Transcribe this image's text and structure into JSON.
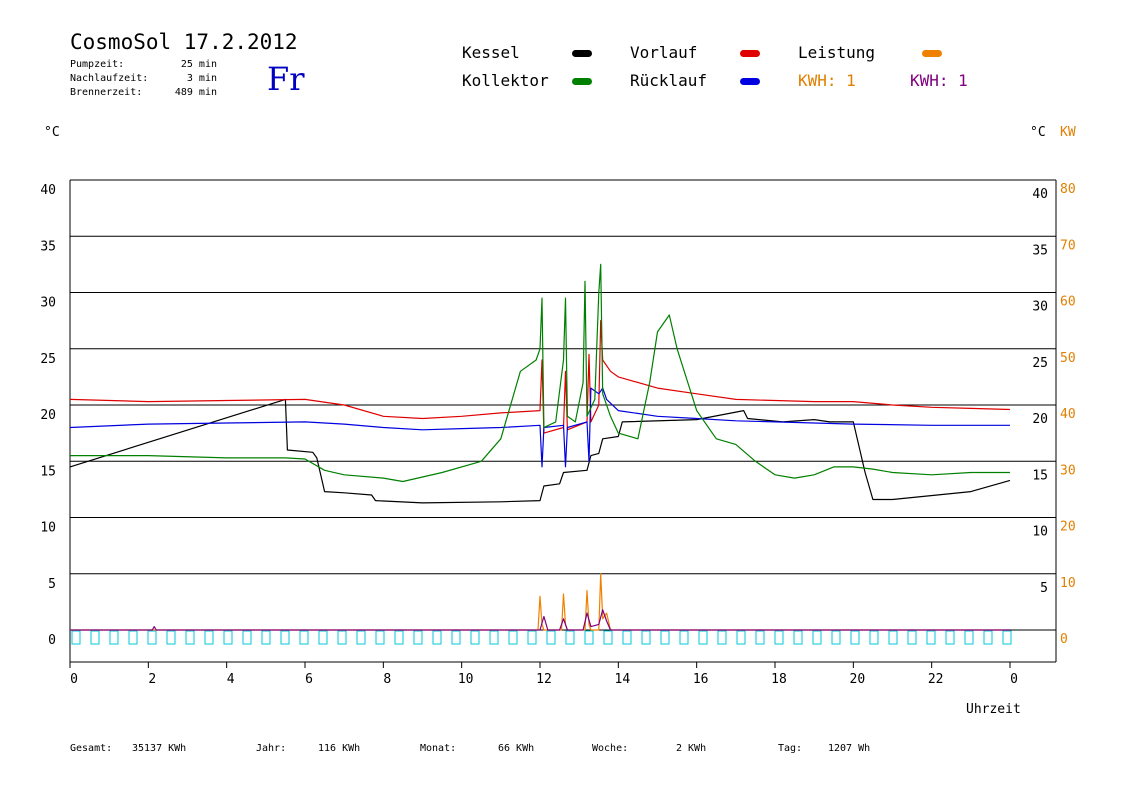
{
  "header": {
    "title": "CosmoSol 17.2.2012",
    "weekday": "Fr",
    "stats": [
      {
        "label": "Pumpzeit:",
        "value": "25 min"
      },
      {
        "label": "Nachlaufzeit:",
        "value": "3 min"
      },
      {
        "label": "Brennerzeit:",
        "value": "489 min"
      }
    ]
  },
  "legend": {
    "items": [
      {
        "label": "Kessel",
        "color": "#000000"
      },
      {
        "label": "Vorlauf",
        "color": "#e00000"
      },
      {
        "label": "Leistung",
        "color": "#f08000"
      },
      {
        "label": "Kollektor",
        "color": "#008000"
      },
      {
        "label": "Rücklauf",
        "color": "#0000e0"
      }
    ],
    "kwh": [
      {
        "label": "KWH: 1",
        "color": "#e08000"
      },
      {
        "label": "KWH: 1",
        "color": "#800080"
      }
    ]
  },
  "axes": {
    "left_unit": "°C",
    "right_unit_c": "°C",
    "right_unit_kw": "KW",
    "xlabel": "Uhrzeit"
  },
  "footer": [
    {
      "label": "Gesamt:",
      "value": "35137 KWh"
    },
    {
      "label": "Jahr:",
      "value": "116 KWh"
    },
    {
      "label": "Monat:",
      "value": "66 KWh"
    },
    {
      "label": "Woche:",
      "value": "2 KWh"
    },
    {
      "label": "Tag:",
      "value": "1207 Wh"
    }
  ],
  "chart_data": {
    "type": "line",
    "xlabel": "Uhrzeit",
    "ylabel": "°C",
    "ylabel_right": "KW",
    "xlim": [
      0,
      24
    ],
    "ylim": [
      -2,
      42
    ],
    "grid": true,
    "x_ticks": [
      "0",
      "2",
      "4",
      "6",
      "8",
      "10",
      "12",
      "14",
      "16",
      "18",
      "20",
      "22",
      "0"
    ],
    "y_ticks_left": [
      "0",
      "5",
      "10",
      "15",
      "20",
      "25",
      "30",
      "35",
      "40"
    ],
    "y_ticks_right_c": [
      "5",
      "10",
      "15",
      "20",
      "25",
      "30",
      "35",
      "40"
    ],
    "y_ticks_right_kw": [
      "0",
      "10",
      "20",
      "30",
      "40",
      "50",
      "60",
      "70",
      "80"
    ],
    "series": [
      {
        "name": "Kessel",
        "color": "#000000",
        "x": [
          0,
          5.5,
          5.55,
          6.2,
          6.3,
          6.5,
          7.0,
          7.7,
          7.8,
          9.0,
          11.0,
          12.0,
          12.1,
          12.5,
          12.6,
          13.2,
          13.3,
          13.5,
          13.6,
          14.0,
          14.1,
          16.0,
          17.2,
          17.3,
          18.2,
          19.0,
          19.4,
          20.0,
          20.3,
          20.5,
          21.0,
          23.0,
          24.0
        ],
        "y": [
          14.5,
          20.5,
          16.0,
          15.8,
          15.3,
          12.3,
          12.2,
          12.0,
          11.5,
          11.3,
          11.4,
          11.5,
          12.8,
          13.0,
          14.0,
          14.2,
          15.5,
          15.7,
          17.0,
          17.2,
          18.5,
          18.7,
          19.5,
          18.8,
          18.5,
          18.7,
          18.5,
          18.5,
          14.0,
          11.6,
          11.6,
          12.3,
          13.3
        ]
      },
      {
        "name": "Vorlauf",
        "color": "#e00000",
        "x": [
          0,
          2,
          4,
          6,
          7,
          8,
          9,
          10,
          11,
          12,
          12.05,
          12.1,
          12.6,
          12.65,
          12.7,
          13.2,
          13.25,
          13.3,
          13.5,
          13.55,
          13.6,
          13.8,
          14.0,
          15.0,
          16.0,
          17.0,
          19.0,
          20.0,
          21.0,
          22.0,
          23.0,
          24.0
        ],
        "y": [
          20.5,
          20.3,
          20.4,
          20.5,
          20.0,
          19.0,
          18.8,
          19.0,
          19.3,
          19.5,
          24.0,
          17.5,
          18.0,
          23.0,
          17.8,
          18.5,
          24.5,
          18.5,
          20.0,
          27.5,
          24.0,
          23.0,
          22.5,
          21.5,
          21.0,
          20.5,
          20.3,
          20.3,
          20.0,
          19.8,
          19.7,
          19.6
        ]
      },
      {
        "name": "Rücklauf",
        "color": "#0000e0",
        "x": [
          0,
          2,
          4,
          6,
          7,
          8,
          9,
          10,
          11,
          12,
          12.05,
          12.1,
          12.6,
          12.65,
          12.7,
          13.2,
          13.25,
          13.3,
          13.5,
          13.6,
          13.7,
          14.0,
          15.0,
          16.0,
          17.0,
          19.0,
          20.0,
          22.0,
          24.0
        ],
        "y": [
          18.0,
          18.3,
          18.4,
          18.5,
          18.3,
          18.0,
          17.8,
          17.9,
          18.0,
          18.2,
          14.5,
          18.0,
          18.2,
          14.5,
          18.0,
          18.5,
          15.0,
          21.5,
          21.0,
          21.5,
          20.5,
          19.5,
          19.0,
          18.8,
          18.6,
          18.4,
          18.3,
          18.2,
          18.2
        ]
      },
      {
        "name": "Kollektor",
        "color": "#008000",
        "x": [
          0,
          2,
          4,
          5.5,
          6.0,
          6.5,
          7.0,
          8.0,
          8.5,
          9.5,
          10.5,
          11.0,
          11.5,
          11.9,
          12.0,
          12.05,
          12.1,
          12.4,
          12.6,
          12.65,
          12.7,
          12.9,
          13.1,
          13.15,
          13.2,
          13.4,
          13.5,
          13.55,
          13.6,
          13.8,
          14.0,
          14.5,
          14.8,
          15.0,
          15.3,
          15.5,
          16.0,
          16.5,
          17.0,
          17.5,
          18.0,
          18.5,
          19.0,
          19.5,
          20.0,
          20.5,
          21.0,
          22.0,
          23.0,
          24.0
        ],
        "y": [
          15.5,
          15.5,
          15.3,
          15.3,
          15.2,
          14.2,
          13.8,
          13.5,
          13.2,
          14.0,
          15.0,
          17.0,
          23.0,
          24.0,
          25.0,
          29.5,
          18.0,
          18.5,
          24.0,
          29.5,
          19.0,
          18.5,
          22.0,
          31.0,
          19.0,
          20.5,
          30.0,
          32.5,
          21.0,
          19.0,
          17.5,
          17.0,
          22.0,
          26.5,
          28.0,
          25.0,
          19.5,
          17.0,
          16.5,
          15.0,
          13.8,
          13.5,
          13.8,
          14.5,
          14.5,
          14.3,
          14.0,
          13.8,
          14.0,
          14.0
        ]
      },
      {
        "name": "Leistung",
        "color": "#f08000",
        "x": [
          0,
          11.95,
          12.0,
          12.05,
          12.1,
          12.55,
          12.6,
          12.65,
          12.7,
          13.15,
          13.2,
          13.25,
          13.3,
          13.5,
          13.55,
          13.6,
          13.7,
          13.8,
          24.0
        ],
        "y": [
          0,
          0,
          3.0,
          0.5,
          0,
          0,
          3.2,
          0.5,
          0,
          0,
          3.5,
          0.5,
          0,
          0,
          5.0,
          1.0,
          1.5,
          0,
          0
        ]
      },
      {
        "name": "KWH",
        "color": "#800080",
        "x": [
          0,
          2.1,
          2.15,
          2.2,
          12.0,
          12.1,
          12.2,
          12.5,
          12.6,
          12.7,
          13.1,
          13.2,
          13.3,
          13.5,
          13.6,
          13.7,
          13.8,
          24.0
        ],
        "y": [
          0,
          0,
          0.3,
          0,
          0,
          1.2,
          0,
          0,
          1.0,
          0,
          0,
          1.5,
          0.3,
          0.5,
          1.8,
          0.8,
          0,
          0
        ]
      }
    ]
  }
}
